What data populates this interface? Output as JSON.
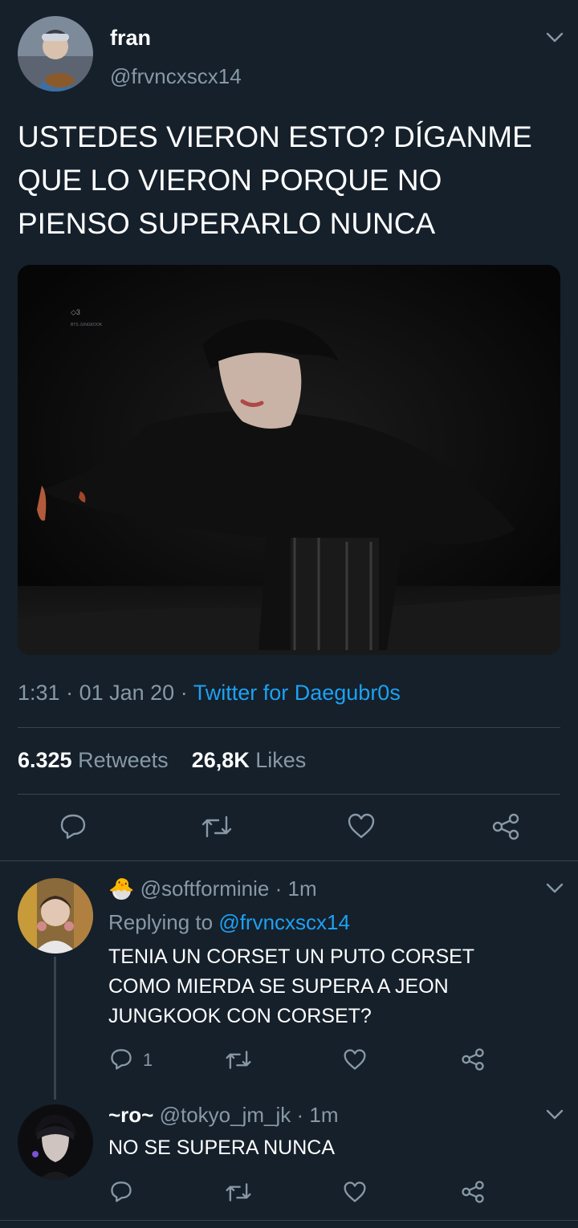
{
  "tweet": {
    "display_name": "fran",
    "handle": "@frvncxscx14",
    "text_line1": "USTEDES VIERON ESTO? DÍGANME",
    "text_line2": "QUE LO VIERON PORQUE NO",
    "text_line3": "PIENSO SUPERARLO NUNCA",
    "media_watermark": "BTS JUNGKOOK",
    "time": "1:31",
    "date": "01 Jan 20",
    "client": "Twitter for Daegubr0s",
    "retweets_count": "6.325",
    "retweets_label": "Retweets",
    "likes_count": "26,8K",
    "likes_label": "Likes"
  },
  "replies": [
    {
      "emoji": "🐣",
      "display_name": "",
      "handle": "@softforminie",
      "age": "· 1m",
      "replying_prefix": "Replying to",
      "replying_handle": "@frvncxscx14",
      "text_line1": "TENIA UN CORSET UN PUTO CORSET",
      "text_line2": "COMO MIERDA SE SUPERA A JEON",
      "text_line3": "JUNGKOOK CON CORSET?",
      "reply_count": "1"
    },
    {
      "display_name": "~ro~",
      "handle": "@tokyo_jm_jk",
      "age": "· 1m",
      "text_line1": "NO SE SUPERA NUNCA"
    }
  ],
  "icons": [
    "chevron-down-icon",
    "reply-icon",
    "retweet-icon",
    "like-icon",
    "share-icon"
  ],
  "colors": {
    "background": "#15202b",
    "link": "#1da1f2",
    "muted": "#8899a6",
    "divider": "#38444d"
  }
}
